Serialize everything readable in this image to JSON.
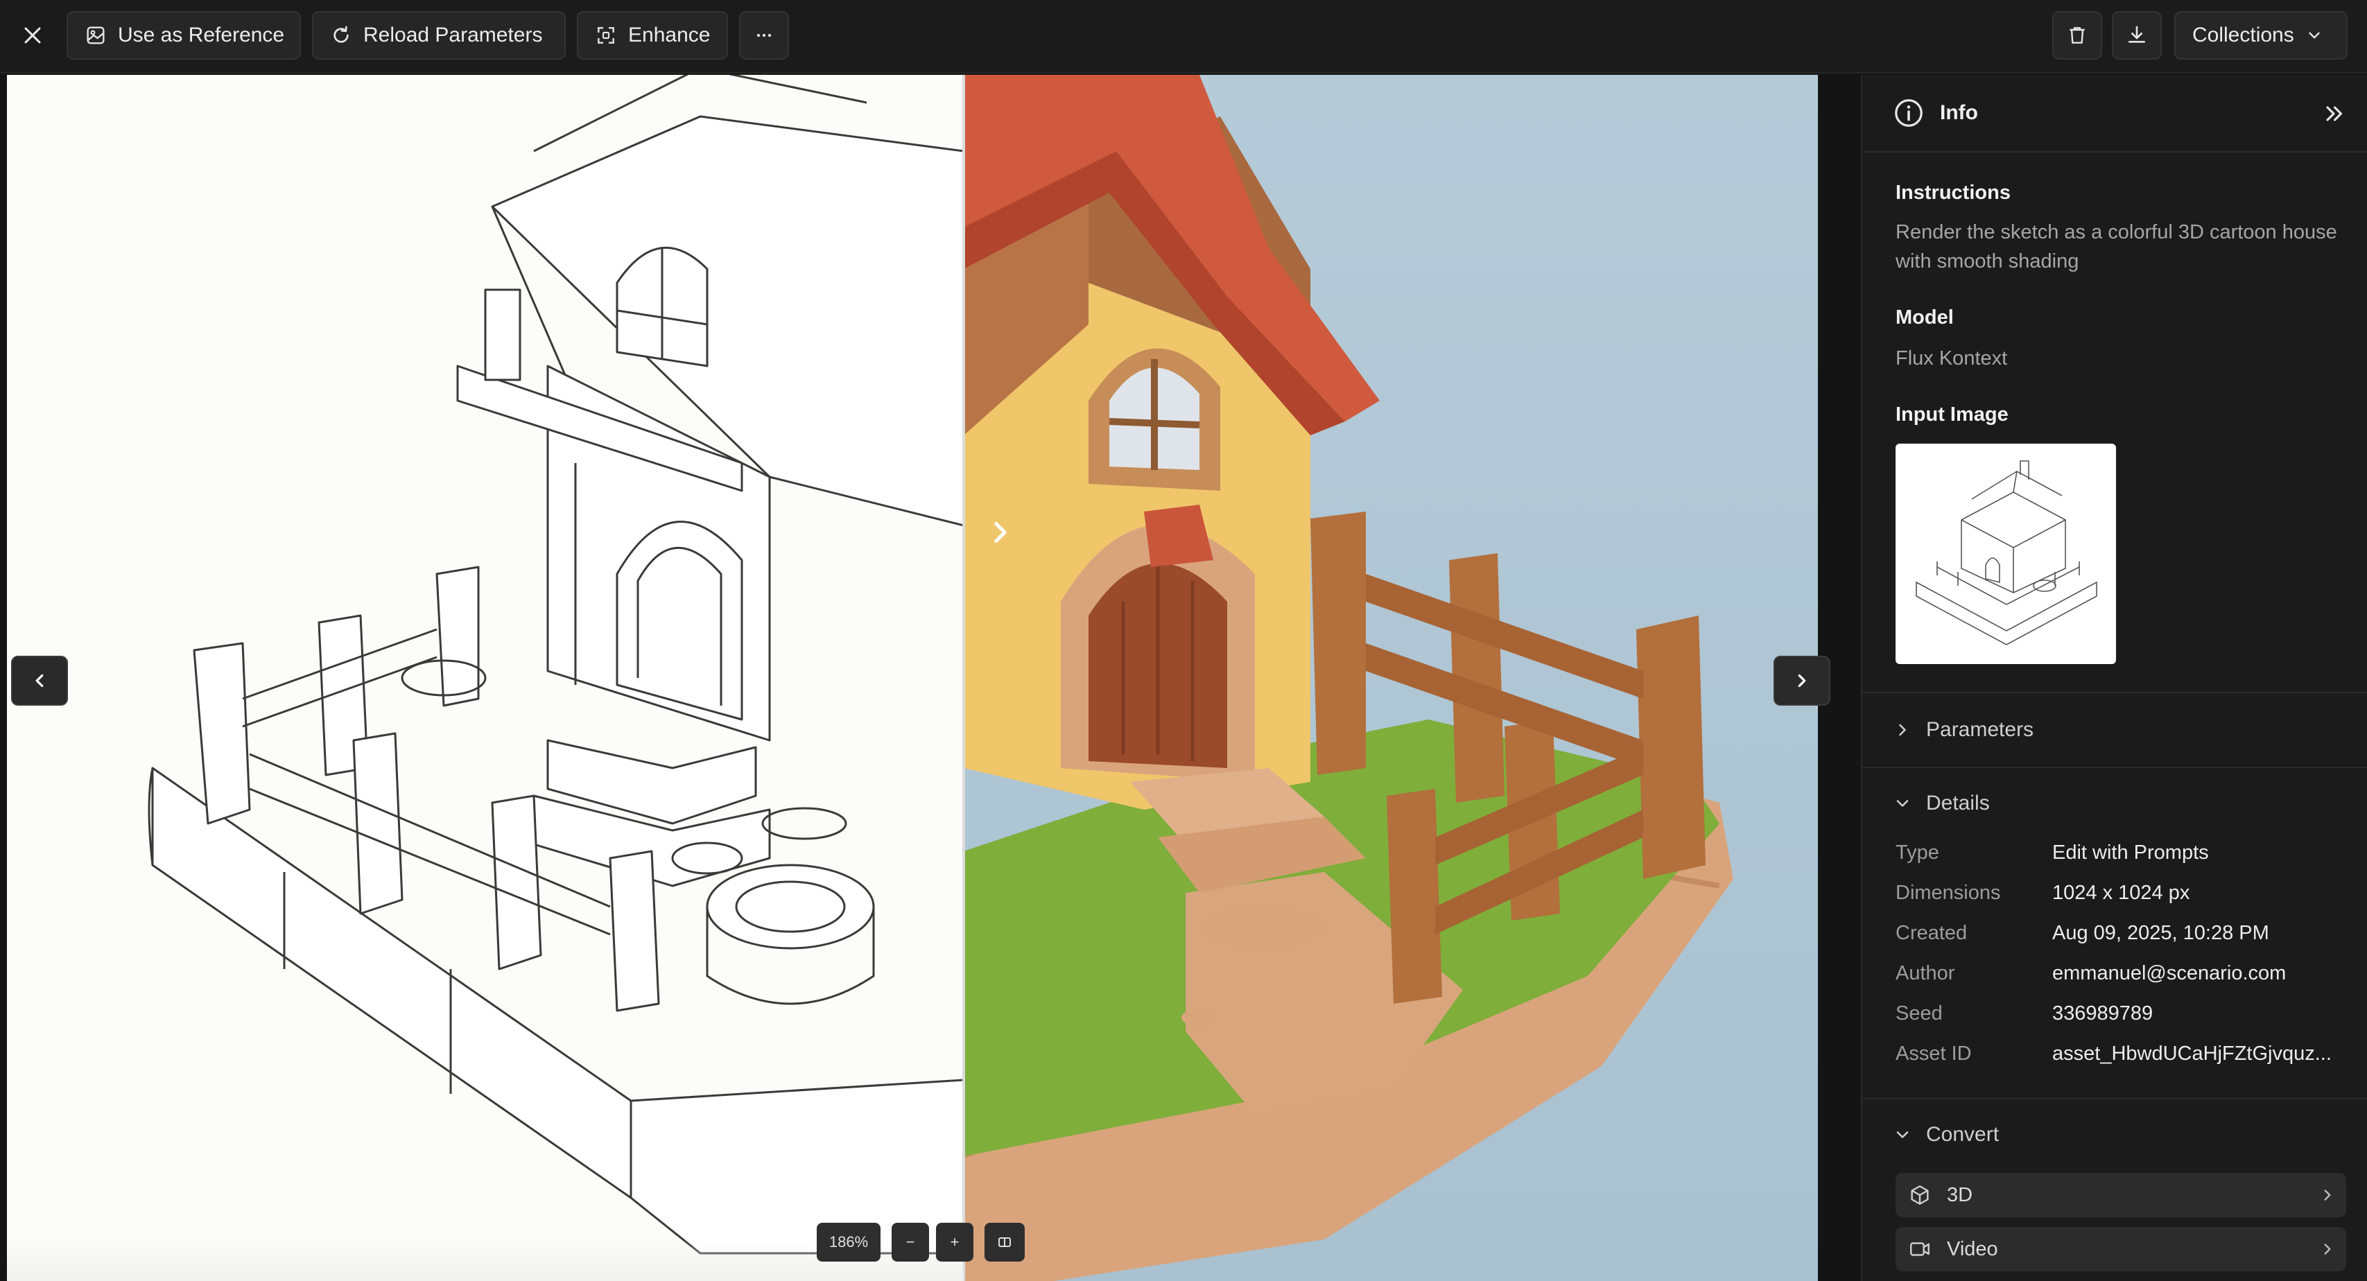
{
  "toolbar": {
    "use_as_reference": "Use as Reference",
    "reload_parameters": "Reload Parameters",
    "enhance": "Enhance",
    "collections": "Collections"
  },
  "canvas": {
    "zoom_level": "186%",
    "zoom_out": "−",
    "zoom_in": "+"
  },
  "panel": {
    "title": "Info",
    "instructions_label": "Instructions",
    "instructions_text": "Render the sketch as a colorful 3D cartoon house with smooth shading",
    "model_label": "Model",
    "model_value": "Flux Kontext",
    "input_image_label": "Input Image",
    "parameters_label": "Parameters",
    "details_label": "Details",
    "details": [
      {
        "key": "Type",
        "value": "Edit with Prompts"
      },
      {
        "key": "Dimensions",
        "value": "1024 x 1024 px"
      },
      {
        "key": "Created",
        "value": "Aug 09, 2025, 10:28 PM"
      },
      {
        "key": "Author",
        "value": "emmanuel@scenario.com"
      },
      {
        "key": "Seed",
        "value": "336989789"
      },
      {
        "key": "Asset ID",
        "value": "asset_HbwdUCaHjFZtGjvquz..."
      }
    ],
    "convert_label": "Convert",
    "convert_options": [
      {
        "label": "3D",
        "icon": "cube-icon"
      },
      {
        "label": "Video",
        "icon": "video-icon"
      }
    ]
  },
  "icons": {
    "close": "close-icon",
    "reference": "image-icon",
    "reload": "refresh-icon",
    "enhance": "enhance-icon",
    "more": "more-icon",
    "delete": "trash-icon",
    "download": "download-icon",
    "collections_chevron": "chevron-down-icon",
    "info": "info-icon",
    "collapse": "double-chevron-right-icon"
  },
  "colors": {
    "background": "#161616",
    "panel": "#1b1b1b",
    "button": "#262626",
    "text": "#ececec",
    "muted_text": "#a6a6a6",
    "sky": "#b1c7d5"
  }
}
